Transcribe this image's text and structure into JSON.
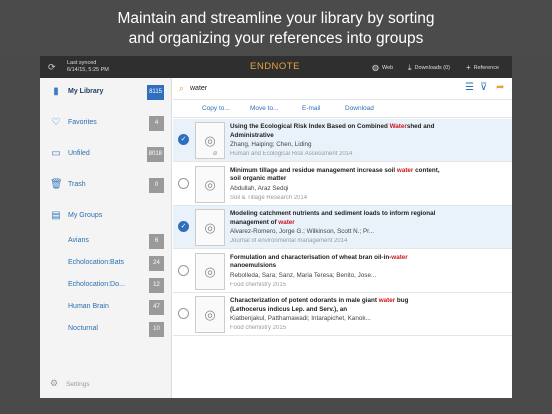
{
  "promo": {
    "line1": "Maintain and streamline your library by sorting",
    "line2": "and organizing your references into groups"
  },
  "topbar": {
    "synced_label": "Last synced",
    "synced_time": "6/14/15, 5:25 PM",
    "logo": "ENDNOTE",
    "web": "Web",
    "downloads": "Downloads (0)",
    "reference": "Reference"
  },
  "sidebar": {
    "items": [
      {
        "label": "My Library",
        "count": "8115",
        "icon": "book-icon"
      },
      {
        "label": "Favorites",
        "count": "4",
        "icon": "heart-icon"
      },
      {
        "label": "Unfiled",
        "count": "8018",
        "icon": "document-icon"
      },
      {
        "label": "Trash",
        "count": "0",
        "icon": "trash-icon"
      },
      {
        "label": "My Groups",
        "count": "",
        "icon": "folder-icon"
      }
    ],
    "groups": [
      {
        "label": "Avians",
        "count": "6"
      },
      {
        "label": "Echolocation:Bats",
        "count": "24"
      },
      {
        "label": "Echolocation:Do...",
        "count": "12"
      },
      {
        "label": "Human Brain",
        "count": "47"
      },
      {
        "label": "Nocturnal",
        "count": "10"
      }
    ],
    "settings": "Settings"
  },
  "search": {
    "value": "water"
  },
  "actions": {
    "copy": "Copy to...",
    "move": "Move to...",
    "email": "E-mail",
    "download": "Download"
  },
  "refs": [
    {
      "selected": true,
      "t1": "Using the Ecological Risk Index Based on Combined ",
      "hl": "Water",
      "t2": "shed and Administrative",
      "authors": "Zhang, Haiping; Chen, Liding",
      "journal": "Human and Ecological Risk Assessment 2014"
    },
    {
      "selected": false,
      "t1": "Minimum tillage and residue management increase soil ",
      "hl": "water",
      "t2": " content, soil organic matter",
      "authors": "Abdullah, Araz Sedqi",
      "journal": "Soil & Tillage Research 2014"
    },
    {
      "selected": true,
      "t1": "Modeling catchment nutrients and sediment loads to inform regional management of ",
      "hl": "water",
      "t2": "",
      "authors": "Alvarez-Romero, Jorge G.; Wilkinson, Scott N.; Pr...",
      "journal": "Journal of environmental management 2014"
    },
    {
      "selected": false,
      "t1": "Formulation and characterisation of wheat bran oil-in-",
      "hl": "water",
      "t2": " nanoemulsions",
      "authors": "Rebolleda, Sara; Sanz, Maria Teresa; Benito, Jose...",
      "journal": "Food chemistry 2015"
    },
    {
      "selected": false,
      "t1": "Characterization of potent odorants in male giant ",
      "hl": "water",
      "t2": " bug (Lethocerus indicus Lep. and Serv.), an",
      "authors": "Kiatbenjakul, Patthamawadi; Intarapichet, Kanok...",
      "journal": "Food chemistry 2015"
    }
  ]
}
